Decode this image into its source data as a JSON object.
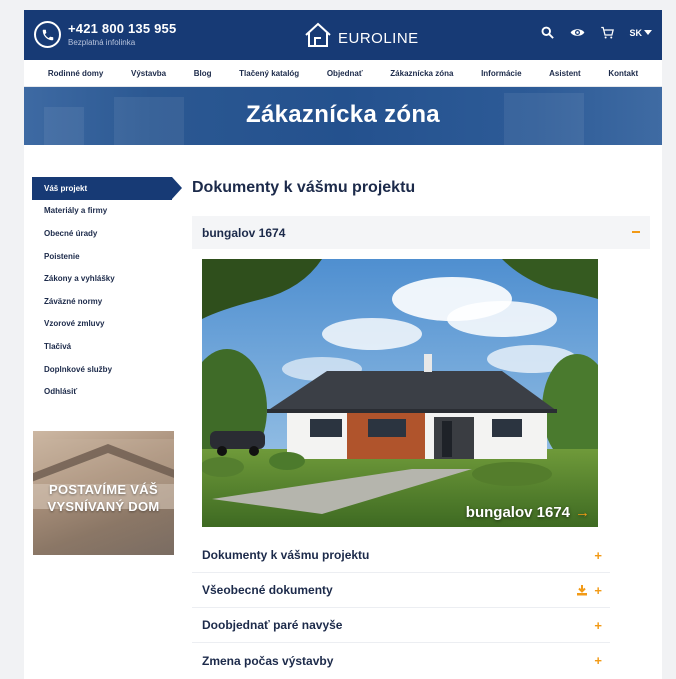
{
  "header": {
    "phone": "+421 800 135 955",
    "phone_sub": "Bezplatná infolinka",
    "logo": "EUROLINE",
    "lang": "SK",
    "icons": [
      "phone-icon",
      "search-icon",
      "eye-icon",
      "cart-icon",
      "chevron-down-icon"
    ]
  },
  "nav": {
    "items": [
      "Rodinné domy",
      "Výstavba",
      "Blog",
      "Tlačený katalóg",
      "Objednať",
      "Zákaznícka zóna",
      "Informácie",
      "Asistent",
      "Kontakt"
    ]
  },
  "hero": {
    "title": "Zákaznícka zóna"
  },
  "sidebar": {
    "items": [
      "Váš projekt",
      "Materiály a firmy",
      "Obecné úrady",
      "Poistenie",
      "Zákony a vyhlášky",
      "Záväzné normy",
      "Vzorové zmluvy",
      "Tlačivá",
      "Doplnkové služby",
      "Odhlásiť"
    ]
  },
  "promo": {
    "line1": "POSTAVÍME VÁŠ",
    "line2": "VYSNÍVANÝ DOM"
  },
  "main": {
    "title": "Dokumenty k vášmu projektu",
    "open_section": "bungalov 1674",
    "photo_caption": "bungalov 1674",
    "sections": [
      "Dokumenty k vášmu projektu",
      "Všeobecné dokumenty",
      "Doobjednať paré navyše",
      "Zmena počas výstavby"
    ]
  },
  "colors": {
    "primary": "#173a75",
    "accent": "#f29a16",
    "text": "#1c2a4a"
  }
}
